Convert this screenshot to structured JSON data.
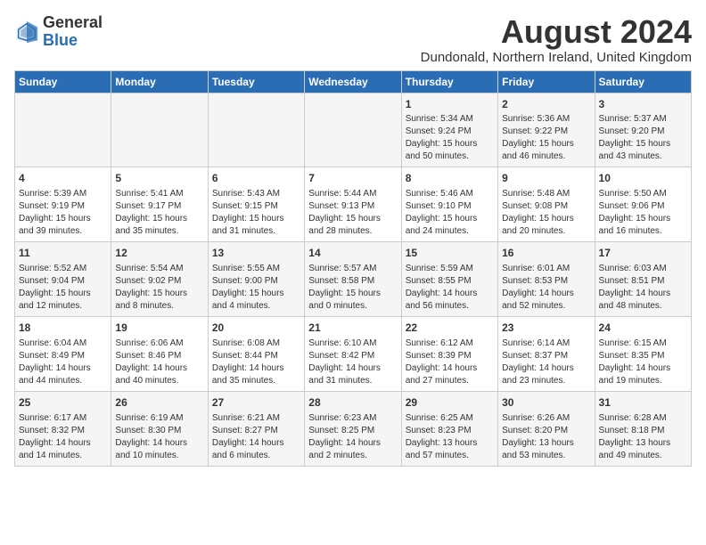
{
  "header": {
    "logo_general": "General",
    "logo_blue": "Blue",
    "title": "August 2024",
    "subtitle": "Dundonald, Northern Ireland, United Kingdom"
  },
  "days_of_week": [
    "Sunday",
    "Monday",
    "Tuesday",
    "Wednesday",
    "Thursday",
    "Friday",
    "Saturday"
  ],
  "weeks": [
    [
      {
        "day": "",
        "text": ""
      },
      {
        "day": "",
        "text": ""
      },
      {
        "day": "",
        "text": ""
      },
      {
        "day": "",
        "text": ""
      },
      {
        "day": "1",
        "text": "Sunrise: 5:34 AM\nSunset: 9:24 PM\nDaylight: 15 hours and 50 minutes."
      },
      {
        "day": "2",
        "text": "Sunrise: 5:36 AM\nSunset: 9:22 PM\nDaylight: 15 hours and 46 minutes."
      },
      {
        "day": "3",
        "text": "Sunrise: 5:37 AM\nSunset: 9:20 PM\nDaylight: 15 hours and 43 minutes."
      }
    ],
    [
      {
        "day": "4",
        "text": "Sunrise: 5:39 AM\nSunset: 9:19 PM\nDaylight: 15 hours and 39 minutes."
      },
      {
        "day": "5",
        "text": "Sunrise: 5:41 AM\nSunset: 9:17 PM\nDaylight: 15 hours and 35 minutes."
      },
      {
        "day": "6",
        "text": "Sunrise: 5:43 AM\nSunset: 9:15 PM\nDaylight: 15 hours and 31 minutes."
      },
      {
        "day": "7",
        "text": "Sunrise: 5:44 AM\nSunset: 9:13 PM\nDaylight: 15 hours and 28 minutes."
      },
      {
        "day": "8",
        "text": "Sunrise: 5:46 AM\nSunset: 9:10 PM\nDaylight: 15 hours and 24 minutes."
      },
      {
        "day": "9",
        "text": "Sunrise: 5:48 AM\nSunset: 9:08 PM\nDaylight: 15 hours and 20 minutes."
      },
      {
        "day": "10",
        "text": "Sunrise: 5:50 AM\nSunset: 9:06 PM\nDaylight: 15 hours and 16 minutes."
      }
    ],
    [
      {
        "day": "11",
        "text": "Sunrise: 5:52 AM\nSunset: 9:04 PM\nDaylight: 15 hours and 12 minutes."
      },
      {
        "day": "12",
        "text": "Sunrise: 5:54 AM\nSunset: 9:02 PM\nDaylight: 15 hours and 8 minutes."
      },
      {
        "day": "13",
        "text": "Sunrise: 5:55 AM\nSunset: 9:00 PM\nDaylight: 15 hours and 4 minutes."
      },
      {
        "day": "14",
        "text": "Sunrise: 5:57 AM\nSunset: 8:58 PM\nDaylight: 15 hours and 0 minutes."
      },
      {
        "day": "15",
        "text": "Sunrise: 5:59 AM\nSunset: 8:55 PM\nDaylight: 14 hours and 56 minutes."
      },
      {
        "day": "16",
        "text": "Sunrise: 6:01 AM\nSunset: 8:53 PM\nDaylight: 14 hours and 52 minutes."
      },
      {
        "day": "17",
        "text": "Sunrise: 6:03 AM\nSunset: 8:51 PM\nDaylight: 14 hours and 48 minutes."
      }
    ],
    [
      {
        "day": "18",
        "text": "Sunrise: 6:04 AM\nSunset: 8:49 PM\nDaylight: 14 hours and 44 minutes."
      },
      {
        "day": "19",
        "text": "Sunrise: 6:06 AM\nSunset: 8:46 PM\nDaylight: 14 hours and 40 minutes."
      },
      {
        "day": "20",
        "text": "Sunrise: 6:08 AM\nSunset: 8:44 PM\nDaylight: 14 hours and 35 minutes."
      },
      {
        "day": "21",
        "text": "Sunrise: 6:10 AM\nSunset: 8:42 PM\nDaylight: 14 hours and 31 minutes."
      },
      {
        "day": "22",
        "text": "Sunrise: 6:12 AM\nSunset: 8:39 PM\nDaylight: 14 hours and 27 minutes."
      },
      {
        "day": "23",
        "text": "Sunrise: 6:14 AM\nSunset: 8:37 PM\nDaylight: 14 hours and 23 minutes."
      },
      {
        "day": "24",
        "text": "Sunrise: 6:15 AM\nSunset: 8:35 PM\nDaylight: 14 hours and 19 minutes."
      }
    ],
    [
      {
        "day": "25",
        "text": "Sunrise: 6:17 AM\nSunset: 8:32 PM\nDaylight: 14 hours and 14 minutes."
      },
      {
        "day": "26",
        "text": "Sunrise: 6:19 AM\nSunset: 8:30 PM\nDaylight: 14 hours and 10 minutes."
      },
      {
        "day": "27",
        "text": "Sunrise: 6:21 AM\nSunset: 8:27 PM\nDaylight: 14 hours and 6 minutes."
      },
      {
        "day": "28",
        "text": "Sunrise: 6:23 AM\nSunset: 8:25 PM\nDaylight: 14 hours and 2 minutes."
      },
      {
        "day": "29",
        "text": "Sunrise: 6:25 AM\nSunset: 8:23 PM\nDaylight: 13 hours and 57 minutes."
      },
      {
        "day": "30",
        "text": "Sunrise: 6:26 AM\nSunset: 8:20 PM\nDaylight: 13 hours and 53 minutes."
      },
      {
        "day": "31",
        "text": "Sunrise: 6:28 AM\nSunset: 8:18 PM\nDaylight: 13 hours and 49 minutes."
      }
    ]
  ]
}
